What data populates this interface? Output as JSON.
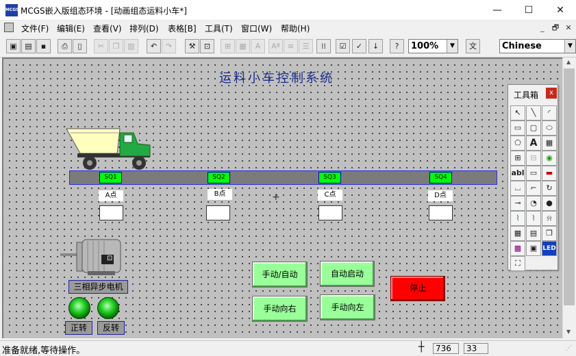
{
  "app": {
    "logo_text": "MCGS",
    "title": "MCGS嵌入版组态环境 - [动画组态运料小车*]"
  },
  "window_controls": {
    "minimize": "—",
    "maximize": "☐",
    "close": "✕"
  },
  "menu": {
    "items": [
      "文件(F)",
      "编辑(E)",
      "查看(V)",
      "排列(D)",
      "表格[B]",
      "工具(T)",
      "窗口(W)",
      "帮助(H)"
    ],
    "mdi_controls": [
      "_",
      "🗗",
      "✕"
    ]
  },
  "toolbar": {
    "zoom_value": "100%",
    "language_value": "Chinese"
  },
  "canvas": {
    "title": "运料小车控制系统",
    "sensors": [
      "SQ1",
      "SQ2",
      "SQ3",
      "SQ4"
    ],
    "points": [
      "A点",
      "B点",
      "C点",
      "D点"
    ],
    "motor_label": "三相异步电机",
    "motor_name_plate": "⊡",
    "forward_label": "正转",
    "reverse_label": "反转",
    "buttons": {
      "manual_auto": "手动/自动",
      "auto_start": "自动启动",
      "manual_right": "手动向右",
      "manual_left": "手动向左",
      "stop": "停止"
    },
    "cursor_mark": "+"
  },
  "toolbox": {
    "title": "工具箱",
    "close": "x"
  },
  "status": {
    "text": "准备就绪,等待操作。",
    "coord_x": "736",
    "coord_y": "33",
    "crosshair": "┼"
  },
  "colors": {
    "sensor": "#00ff00",
    "button": "#99ff99",
    "stop": "#ff0000",
    "title": "#1b2c8e"
  }
}
